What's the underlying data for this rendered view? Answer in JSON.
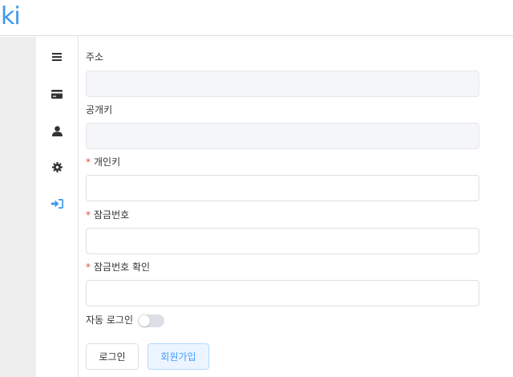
{
  "header": {
    "logo_text": "ki",
    "logo_color": "#3d98ec"
  },
  "sidebar": {
    "items": [
      {
        "icon": "menu-icon",
        "color": "#333333"
      },
      {
        "icon": "credit-card-icon",
        "color": "#333333"
      },
      {
        "icon": "user-icon",
        "color": "#333333"
      },
      {
        "icon": "gear-icon",
        "color": "#333333"
      },
      {
        "icon": "sign-in-icon",
        "color": "#3d98ec",
        "active": true
      }
    ]
  },
  "form": {
    "address": {
      "label": "주소",
      "value": "",
      "disabled": true
    },
    "public_key": {
      "label": "공개키",
      "value": "",
      "disabled": true
    },
    "private_key": {
      "required_mark": "*",
      "label": "개인키",
      "value": ""
    },
    "password": {
      "required_mark": "*",
      "label": "잠금번호",
      "value": ""
    },
    "password_confirm": {
      "required_mark": "*",
      "label": "잠금번호 확인",
      "value": ""
    },
    "auto_login": {
      "label": "자동 로그인",
      "enabled": false
    }
  },
  "buttons": {
    "login": "로그인",
    "signup": "회원가입"
  },
  "colors": {
    "required": "#e54b4b",
    "accent": "#409eff"
  }
}
